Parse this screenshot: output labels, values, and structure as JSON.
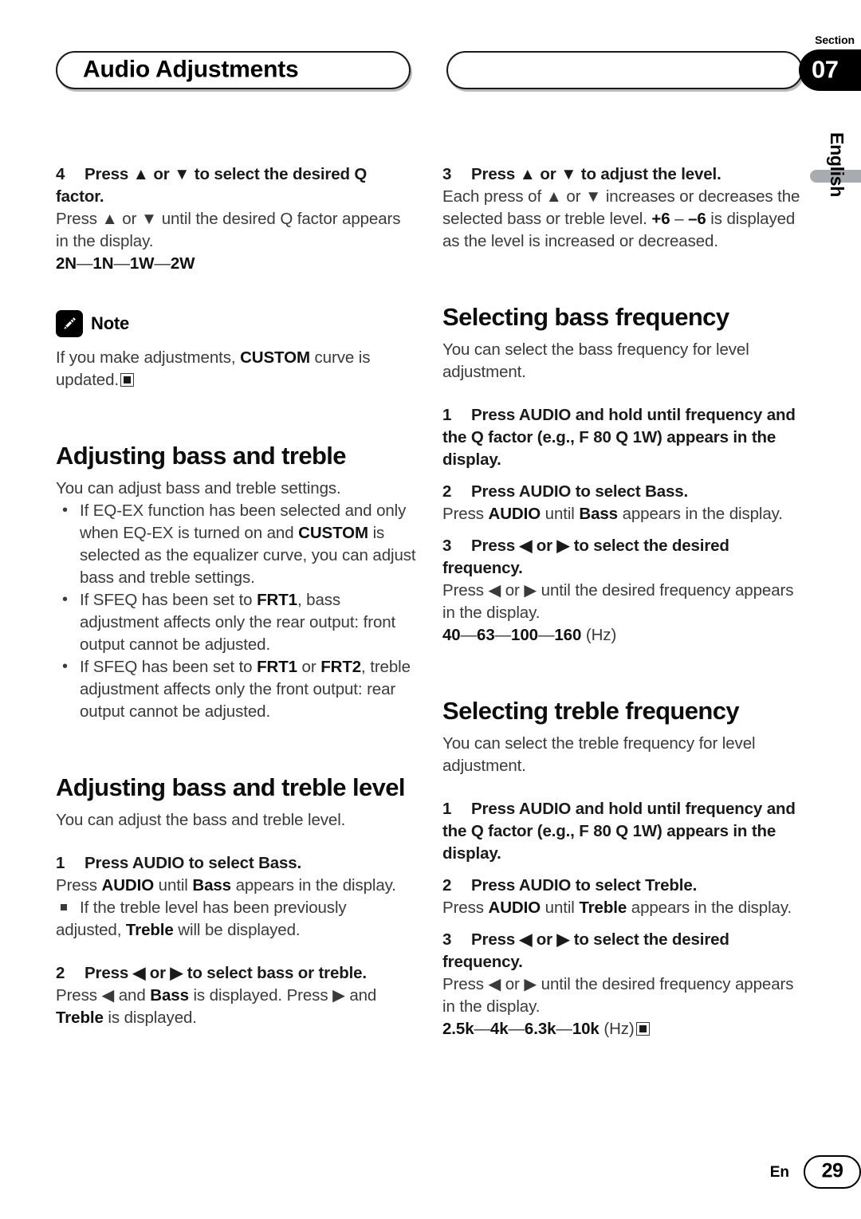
{
  "header": {
    "title": "Audio Adjustments",
    "blank_pill": "",
    "section_label": "Section",
    "section_number": "07"
  },
  "side_tab": {
    "language": "English"
  },
  "footer": {
    "language_code": "En",
    "page_number": "29"
  },
  "left_column": {
    "step4": {
      "number": "4",
      "heading": "Press ▲ or ▼ to select the desired Q factor.",
      "body": "Press ▲ or ▼ until the desired Q factor appears in the display.",
      "chain": [
        "2N",
        "1N",
        "1W",
        "2W"
      ]
    },
    "note": {
      "icon": "pencil-icon",
      "label": "Note",
      "text_before_custom": "If you make adjustments, ",
      "custom": "CUSTOM",
      "text_after_custom": " curve is updated.",
      "end_marker": "■"
    },
    "section_bass_treble": {
      "heading": "Adjusting bass and treble",
      "intro": "You can adjust bass and treble settings.",
      "bullets": [
        "If EQ-EX function has been selected and only when EQ-EX is turned on and CUSTOM is selected as the equalizer curve, you can adjust bass and treble settings.",
        "If SFEQ has been set to FRT1, bass adjustment affects only the rear output: front output cannot be adjusted.",
        "If SFEQ has been set to FRT1 or FRT2, treble adjustment affects only the front output: rear output cannot be adjusted."
      ]
    },
    "section_bass_treble_level": {
      "heading": "Adjusting bass and treble level",
      "intro": "You can adjust the bass and treble level.",
      "step1": {
        "number": "1",
        "heading": "Press AUDIO to select Bass.",
        "body": "Press AUDIO until Bass appears in the display.",
        "sub_note": "If the treble level has been previously adjusted, Treble will be displayed."
      },
      "step2": {
        "number": "2",
        "heading": "Press ◀ or ▶ to select bass or treble.",
        "body": "Press ◀ and Bass is displayed. Press ▶ and Treble is displayed."
      }
    }
  },
  "right_column": {
    "step3": {
      "number": "3",
      "heading": "Press ▲ or ▼ to adjust the level.",
      "body": "Each press of ▲ or ▼ increases or decreases the selected bass or treble level. +6 – –6 is displayed as the level is increased or decreased."
    },
    "section_bass_frequency": {
      "heading": "Selecting bass frequency",
      "intro": "You can select the bass frequency for level adjustment.",
      "step1": {
        "number": "1",
        "heading": "Press AUDIO and hold until frequency and the Q factor (e.g., F 80 Q 1W) appears in the display."
      },
      "step2": {
        "number": "2",
        "heading": "Press AUDIO to select Bass.",
        "body": "Press AUDIO until Bass appears in the display."
      },
      "step3": {
        "number": "3",
        "heading": "Press ◀ or ▶ to select the desired frequency.",
        "body": "Press ◀ or ▶ until the desired frequency appears in the display.",
        "chain": [
          "40",
          "63",
          "100",
          "160"
        ],
        "chain_unit": "(Hz)"
      }
    },
    "section_treble_frequency": {
      "heading": "Selecting treble frequency",
      "intro": "You can select the treble frequency for level adjustment.",
      "step1": {
        "number": "1",
        "heading": "Press AUDIO and hold until frequency and the Q factor (e.g., F 80 Q 1W) appears in the display."
      },
      "step2": {
        "number": "2",
        "heading": "Press AUDIO to select Treble.",
        "body": "Press AUDIO until Treble appears in the display."
      },
      "step3": {
        "number": "3",
        "heading": "Press ◀ or ▶ to select the desired frequency.",
        "body": "Press ◀ or ▶ until the desired frequency appears in the display.",
        "chain": [
          "2.5k",
          "4k",
          "6.3k",
          "10k"
        ],
        "chain_unit": "(Hz)",
        "end_marker": "■"
      }
    }
  },
  "colors": {
    "accent_black": "#000000",
    "body_gray": "#3a3a3c",
    "tab_gray": "#a8abb0"
  }
}
